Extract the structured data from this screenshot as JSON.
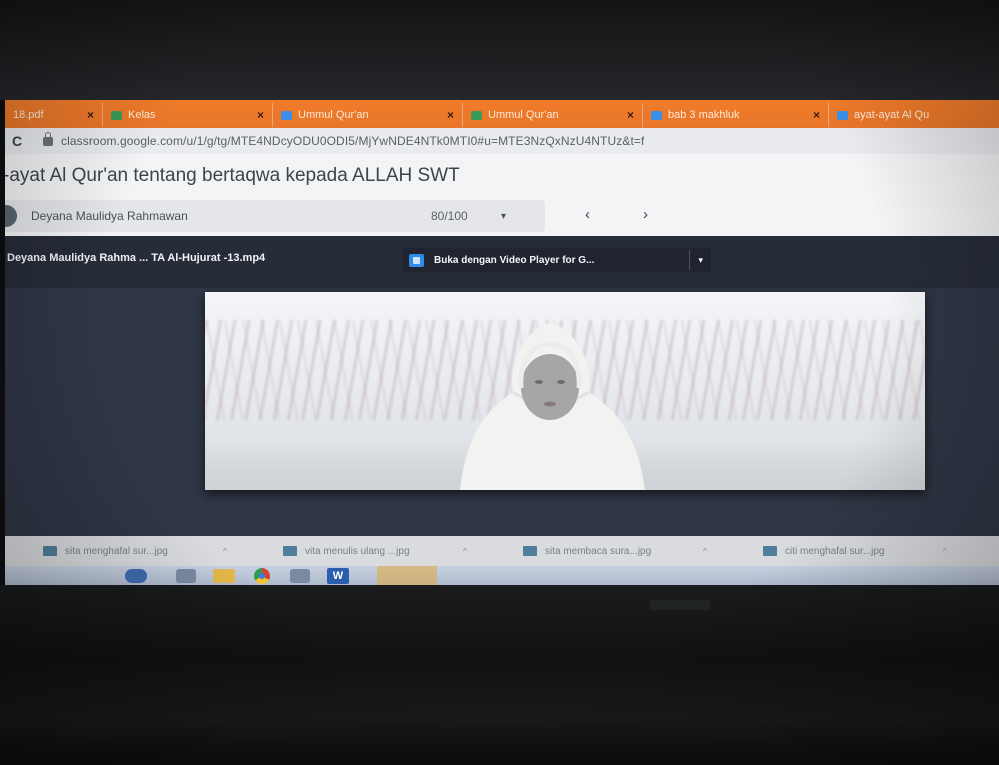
{
  "browser": {
    "tabs": [
      {
        "label": "18.pdf",
        "icon": "pdf-icon",
        "close": "×"
      },
      {
        "label": "Kelas",
        "icon": "classroom-icon",
        "close": "×"
      },
      {
        "label": "Ummul Qur'an",
        "icon": "classroom-icon",
        "close": "×"
      },
      {
        "label": "Ummul Qur'an",
        "icon": "classroom-icon",
        "close": "×"
      },
      {
        "label": "bab 3 makhluk",
        "icon": "classroom-icon",
        "close": "×"
      },
      {
        "label": "ayat-ayat Al Qu",
        "icon": "classroom-icon",
        "close": "×"
      }
    ],
    "reload_glyph": "C",
    "url": "classroom.google.com/u/1/g/tg/MTE4NDcyODU0ODI5/MjYwNDE4NTk0MTI0#u=MTE3NzQxNzU4NTUz&t=f"
  },
  "classroom": {
    "title": "-ayat Al Qur'an tentang bertaqwa kepada ALLAH SWT",
    "student_name": "Deyana Maulidya Rahmawan",
    "grade": "80/100",
    "grade_caret": "▾",
    "prev": "‹",
    "next": "›"
  },
  "viewer": {
    "file_name": "Deyana Maulidya Rahma ... TA Al-Hujurat -13.mp4",
    "open_with_label": "Buka dengan Video Player for G...",
    "open_with_caret": "▾"
  },
  "downloads": [
    {
      "name": "sita menghafal sur...jpg"
    },
    {
      "name": "vita menulis ulang ...jpg"
    },
    {
      "name": "sita membaca sura...jpg"
    },
    {
      "name": "citi menghafal sur...jpg"
    }
  ],
  "taskbar": {
    "word_glyph": "W"
  },
  "colors": {
    "tab_strip": "#e8762a",
    "viewer_bg": "#2f3645",
    "open_with_icon": "#2f8de8"
  }
}
